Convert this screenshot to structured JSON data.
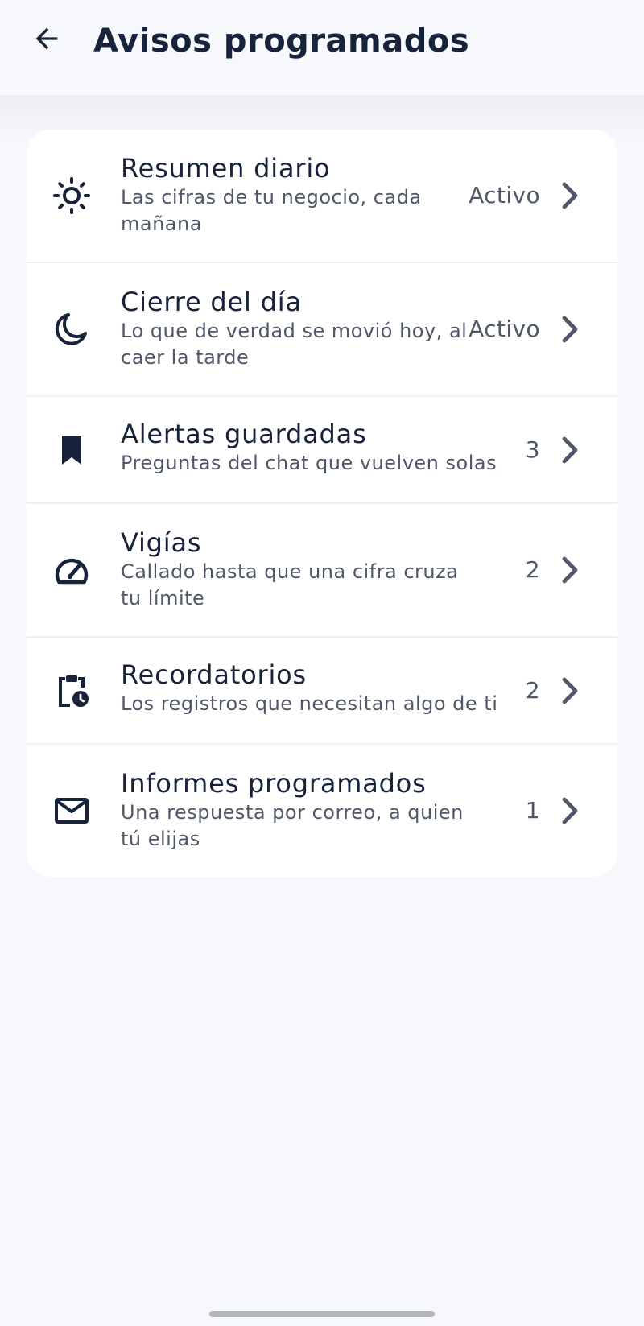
{
  "header": {
    "title": "Avisos programados",
    "back_icon": "arrow-back-icon"
  },
  "items": [
    {
      "title": "Resumen diario",
      "subtitle": "Las cifras de tu negocio, cada mañana",
      "status": "Activo",
      "icon": "sun-icon"
    },
    {
      "title": "Cierre del día",
      "subtitle": "Lo que de verdad se movió hoy, al caer la tarde",
      "status": "Activo",
      "icon": "moon-icon"
    },
    {
      "title": "Alertas guardadas",
      "subtitle": "Preguntas del chat que vuelven solas",
      "status": "3",
      "icon": "bookmark-icon"
    },
    {
      "title": "Vigías",
      "subtitle": "Callado hasta que una cifra cruza tu límite",
      "status": "2",
      "icon": "speedometer-icon"
    },
    {
      "title": "Recordatorios",
      "subtitle": "Los registros que necesitan algo de ti",
      "status": "2",
      "icon": "clipboard-clock-icon"
    },
    {
      "title": "Informes programados",
      "subtitle": "Una respuesta por correo, a quien tú elijas",
      "status": "1",
      "icon": "mail-icon"
    }
  ],
  "colors": {
    "background": "#f7f8fc",
    "card": "#ffffff",
    "text_primary": "#17223b",
    "text_secondary": "#4f5868",
    "divider": "#eef0f3"
  }
}
